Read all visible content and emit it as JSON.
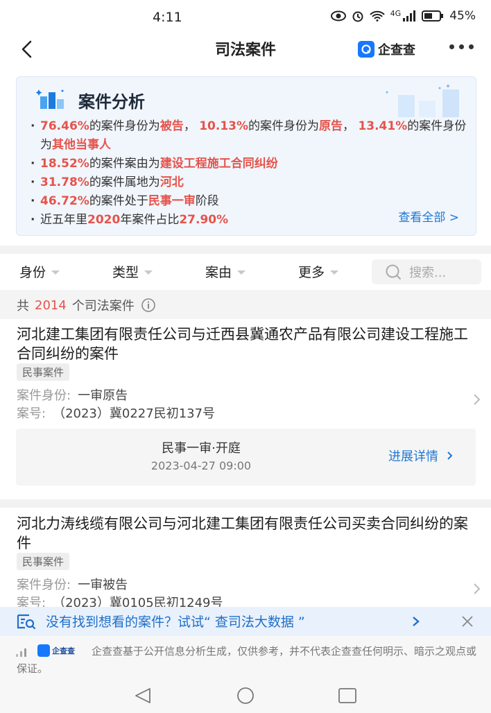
{
  "status_bar": {
    "time": "4:11",
    "battery": "45%",
    "network": "4G"
  },
  "nav": {
    "title": "司法案件",
    "brand": "企查查"
  },
  "analysis": {
    "title": "案件分析",
    "lines": [
      [
        {
          "t": "76.46%",
          "h": true
        },
        {
          "t": "的案件身份为"
        },
        {
          "t": "被告",
          "h": true
        },
        {
          "t": "，  "
        },
        {
          "t": "10.13%",
          "h": true
        },
        {
          "t": "的案件身份为"
        },
        {
          "t": "原告",
          "h": true
        },
        {
          "t": "，  "
        },
        {
          "t": "13.41%",
          "h": true
        },
        {
          "t": "的案件身份为"
        },
        {
          "t": "其他当事人",
          "h": true
        }
      ],
      [
        {
          "t": "18.52%",
          "h": true
        },
        {
          "t": "的案件案由为"
        },
        {
          "t": "建设工程施工合同纠纷",
          "h": true
        }
      ],
      [
        {
          "t": "31.78%",
          "h": true
        },
        {
          "t": "的案件属地为"
        },
        {
          "t": "河北",
          "h": true
        }
      ],
      [
        {
          "t": "46.72%",
          "h": true
        },
        {
          "t": "的案件处于"
        },
        {
          "t": "民事一审",
          "h": true
        },
        {
          "t": "阶段"
        }
      ],
      [
        {
          "t": "近五年里"
        },
        {
          "t": "2020",
          "h": true
        },
        {
          "t": "年案件占比"
        },
        {
          "t": "27.90%",
          "h": true
        }
      ]
    ],
    "view_all": "查看全部 >"
  },
  "filters": {
    "items": [
      "身份",
      "类型",
      "案由",
      "更多"
    ],
    "search_placeholder": "搜索..."
  },
  "count": {
    "prefix": "共",
    "number": "2014",
    "suffix": "个司法案件"
  },
  "cases": [
    {
      "title": "河北建工集团有限责任公司与迁西县冀通农产品有限公司建设工程施工合同纠纷的案件",
      "tag": "民事案件",
      "role_label": "案件身份:",
      "role_value": "一审原告",
      "no_label": "案号:",
      "no_value": "（2023）冀0227民初137号",
      "progress": {
        "stage": "民事一审·开庭",
        "date": "2023-04-27 09:00",
        "link": "进展详情"
      }
    },
    {
      "title": "河北力涛线缆有限公司与河北建工集团有限责任公司买卖合同纠纷的案件",
      "tag": "民事案件",
      "role_label": "案件身份:",
      "role_value": "一审被告",
      "no_label": "案号:",
      "no_value": "（2023）冀0105民初1249号"
    }
  ],
  "banner": {
    "text": "没有找到想看的案件？试试“ 查司法大数据 ”"
  },
  "disclaimer": {
    "logo_text": "企查查",
    "text": "企查查基于公开信息分析生成，仅供参考，并不代表企查查任何明示、暗示之观点或保证。"
  },
  "colors": {
    "accent_blue": "#1f78d1",
    "highlight_red": "#e5534b"
  },
  "icons": [
    "back-icon",
    "more-icon",
    "info-icon",
    "search-icon",
    "chevron-right-icon",
    "close-icon",
    "data-search-icon"
  ]
}
